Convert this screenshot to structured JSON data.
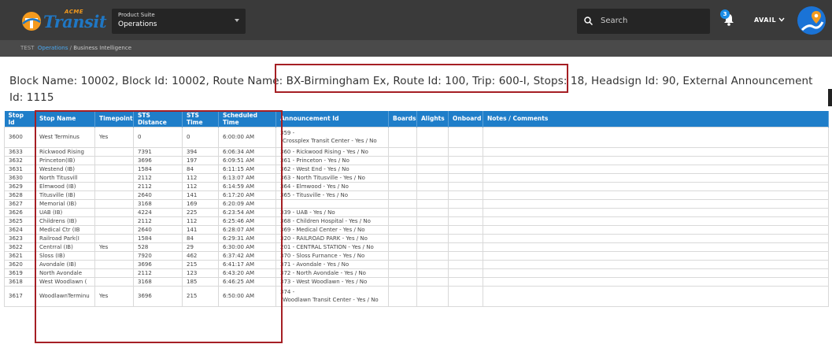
{
  "brand": {
    "acme": "ACME",
    "name": "Transit"
  },
  "product_suite": {
    "label": "Product Suite",
    "value": "Operations"
  },
  "search": {
    "placeholder": "Search"
  },
  "notifications": {
    "count": "3"
  },
  "user": {
    "name": "AVAIL"
  },
  "breadcrumb": {
    "env": "TEST",
    "section": "Operations",
    "separator": "/",
    "page": "Business Intelligence"
  },
  "block_info": "Block Name: 10002, Block Id: 10002, Route Name: BX-Birmingham Ex, Route Id: 100, Trip: 600-I, Stops: 18, Headsign Id: 90, External Announcement Id: 1115",
  "table": {
    "columns": [
      "Stop Id",
      "Stop Name",
      "Timepoint",
      "STS Distance",
      "STS Time",
      "Scheduled Time",
      "Announcement Id",
      "Boards",
      "Alights",
      "Onboard",
      "Notes / Comments"
    ],
    "rows": [
      [
        "3600",
        "West Terminus",
        "Yes",
        "0",
        "0",
        "6:00:00 AM",
        "359 -\nCrossplex Transit Center - Yes / No",
        "",
        "",
        "",
        ""
      ],
      [
        "3633",
        "Rickwood Rising",
        "",
        "7391",
        "394",
        "6:06:34 AM",
        "360 - Rickwood Rising - Yes / No",
        "",
        "",
        "",
        ""
      ],
      [
        "3632",
        "Princeton(IB)",
        "",
        "3696",
        "197",
        "6:09:51 AM",
        "361 - Princeton - Yes / No",
        "",
        "",
        "",
        ""
      ],
      [
        "3631",
        "Westend (IB)",
        "",
        "1584",
        "84",
        "6:11:15 AM",
        "362 - West End - Yes / No",
        "",
        "",
        "",
        ""
      ],
      [
        "3630",
        "North Titusvill",
        "",
        "2112",
        "112",
        "6:13:07 AM",
        "363 - North Titusville - Yes / No",
        "",
        "",
        "",
        ""
      ],
      [
        "3629",
        "Elmwood (IB)",
        "",
        "2112",
        "112",
        "6:14:59 AM",
        "364 - Elmwood - Yes / No",
        "",
        "",
        "",
        ""
      ],
      [
        "3628",
        "Titusville (IB)",
        "",
        "2640",
        "141",
        "6:17:20 AM",
        "365 - Titusville - Yes / No",
        "",
        "",
        "",
        ""
      ],
      [
        "3627",
        "Memorial (IB)",
        "",
        "3168",
        "169",
        "6:20:09 AM",
        "",
        "",
        "",
        "",
        ""
      ],
      [
        "3626",
        "UAB (IB)",
        "",
        "4224",
        "225",
        "6:23:54 AM",
        "339 - UAB - Yes / No",
        "",
        "",
        "",
        ""
      ],
      [
        "3625",
        "Childrens (IB)",
        "",
        "2112",
        "112",
        "6:25:46 AM",
        "368 - Children Hospital - Yes / No",
        "",
        "",
        "",
        ""
      ],
      [
        "3624",
        "Medical Ctr (IB",
        "",
        "2640",
        "141",
        "6:28:07 AM",
        "369 - Medical Center - Yes / No",
        "",
        "",
        "",
        ""
      ],
      [
        "3623",
        "Railroad Park(I",
        "",
        "1584",
        "84",
        "6:29:31 AM",
        "320 - RAILROAD PARK - Yes / No",
        "",
        "",
        "",
        ""
      ],
      [
        "3622",
        "Centrral (IB)",
        "Yes",
        "528",
        "29",
        "6:30:00 AM",
        "201 - CENTRAL STATION - Yes / No",
        "",
        "",
        "",
        ""
      ],
      [
        "3621",
        "Sloss (IB)",
        "",
        "7920",
        "462",
        "6:37:42 AM",
        "370 - Sloss Furnance - Yes / No",
        "",
        "",
        "",
        ""
      ],
      [
        "3620",
        "Avondale (IB)",
        "",
        "3696",
        "215",
        "6:41:17 AM",
        "371 - Avondale - Yes / No",
        "",
        "",
        "",
        ""
      ],
      [
        "3619",
        "North Avondale",
        "",
        "2112",
        "123",
        "6:43:20 AM",
        "372 - North Avondale - Yes / No",
        "",
        "",
        "",
        ""
      ],
      [
        "3618",
        "West Woodlawn (",
        "",
        "3168",
        "185",
        "6:46:25 AM",
        "373 - West Woodlawn - Yes / No",
        "",
        "",
        "",
        ""
      ],
      [
        "3617",
        "WoodlawnTerminu",
        "Yes",
        "3696",
        "215",
        "6:50:00 AM",
        "374 -\nWoodlawn Transit Center - Yes / No",
        "",
        "",
        "",
        ""
      ]
    ]
  },
  "colors": {
    "header_blue": "#1f7ec9",
    "highlight_red": "#a51f24",
    "topbar": "#3a3a3a",
    "link_blue": "#4aa8f0"
  }
}
